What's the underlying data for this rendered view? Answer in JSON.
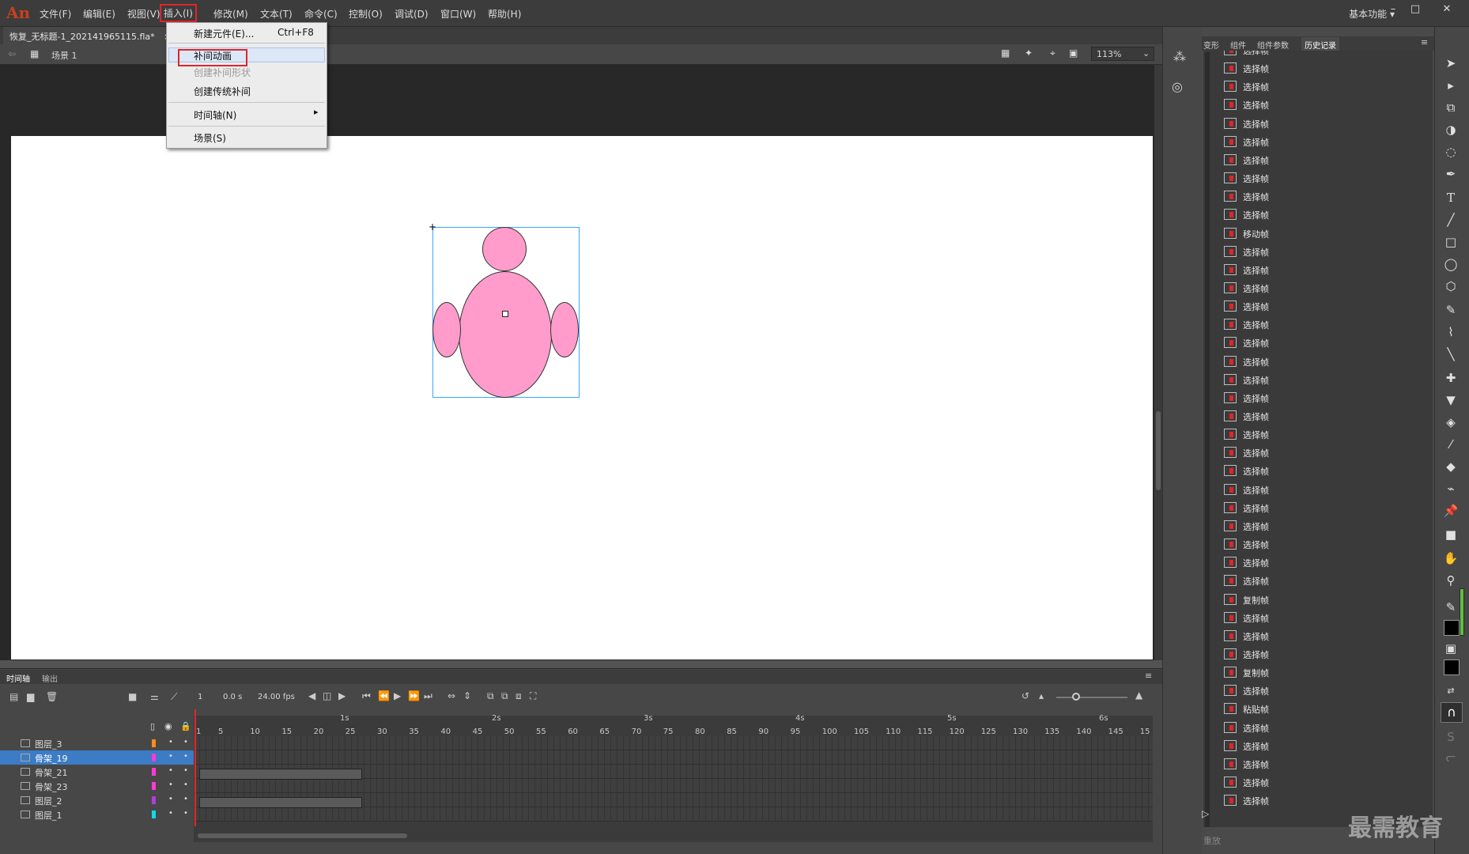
{
  "app": {
    "logo": "An",
    "workspace": "基本功能"
  },
  "menubar": [
    {
      "label": "文件(F)"
    },
    {
      "label": "编辑(E)"
    },
    {
      "label": "视图(V)"
    },
    {
      "label": "插入(I)"
    },
    {
      "label": "修改(M)"
    },
    {
      "label": "文本(T)"
    },
    {
      "label": "命令(C)"
    },
    {
      "label": "控制(O)"
    },
    {
      "label": "调试(D)"
    },
    {
      "label": "窗口(W)"
    },
    {
      "label": "帮助(H)"
    }
  ],
  "insert_menu": {
    "new_symbol": "新建元件(E)...",
    "new_symbol_shortcut": "Ctrl+F8",
    "motion_tween": "补间动画",
    "shape_tween": "创建补间形状",
    "classic_tween": "创建传统补间",
    "timeline": "时间轴(N)",
    "scene": "场景(S)"
  },
  "document": {
    "tab": "恢复_无标题-1_202141965115.fla*",
    "close": "×",
    "scene": "场景 1",
    "zoom": "113%"
  },
  "history": {
    "tabs": [
      "变形",
      "组件",
      "组件参数",
      "历史记录"
    ],
    "items": [
      "选择帧",
      "选择帧",
      "选择帧",
      "选择帧",
      "选择帧",
      "选择帧",
      "选择帧",
      "选择帧",
      "选择帧",
      "选择帧",
      "移动帧",
      "选择帧",
      "选择帧",
      "选择帧",
      "选择帧",
      "选择帧",
      "选择帧",
      "选择帧",
      "选择帧",
      "选择帧",
      "选择帧",
      "选择帧",
      "选择帧",
      "选择帧",
      "选择帧",
      "选择帧",
      "选择帧",
      "选择帧",
      "选择帧",
      "选择帧",
      "复制帧",
      "选择帧",
      "选择帧",
      "选择帧",
      "复制帧",
      "选择帧",
      "粘贴帧",
      "选择帧",
      "选择帧",
      "选择帧",
      "选择帧",
      "选择帧"
    ],
    "replay": "重放"
  },
  "timeline": {
    "tabs": [
      "时间轴",
      "输出"
    ],
    "frame": "1",
    "time": "0.0 s",
    "fps": "24.00 fps",
    "layers": [
      {
        "name": "图层_3",
        "color": "#ff8a1f"
      },
      {
        "name": "骨架_19",
        "color": "#ff3ad8"
      },
      {
        "name": "骨架_21",
        "color": "#ff3ad8"
      },
      {
        "name": "骨架_23",
        "color": "#ff3ad8"
      },
      {
        "name": "图层_2",
        "color": "#b03de0"
      },
      {
        "name": "图层_1",
        "color": "#12d8e8"
      }
    ],
    "ruler": [
      "1",
      "5",
      "10",
      "15",
      "20",
      "25",
      "30",
      "35",
      "40",
      "45",
      "50",
      "55",
      "60",
      "65",
      "70",
      "75",
      "80",
      "85",
      "90",
      "95",
      "100",
      "105",
      "110",
      "115",
      "120",
      "125",
      "130",
      "135",
      "140",
      "145",
      "15"
    ],
    "seconds": [
      "1s",
      "2s",
      "3s",
      "4s",
      "5s",
      "6s"
    ]
  },
  "watermark": "最需教育"
}
